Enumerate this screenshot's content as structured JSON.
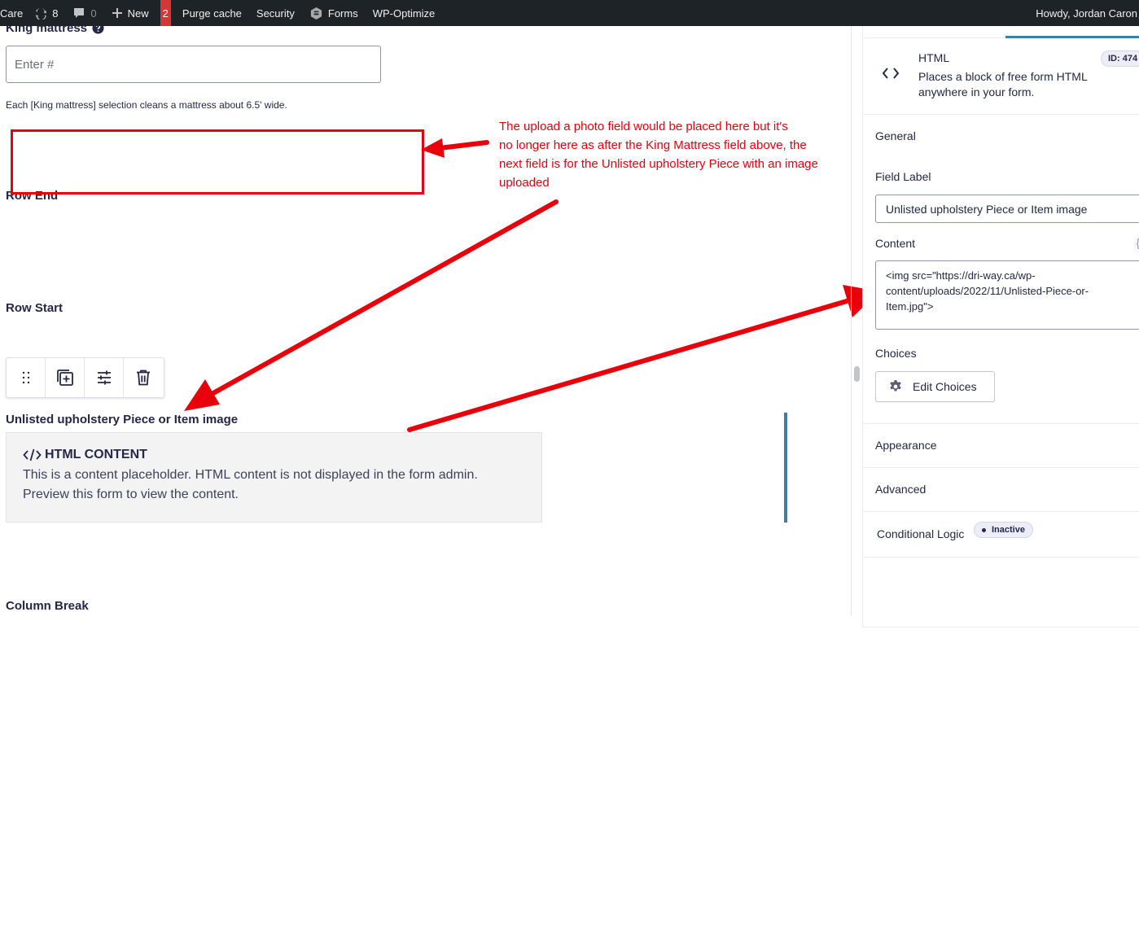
{
  "admin_bar": {
    "site": "Care",
    "updates_count": "8",
    "comments_count": "0",
    "new_label": "New",
    "badge_count": "2",
    "purge_cache": "Purge cache",
    "security": "Security",
    "forms": "Forms",
    "wp_optimize": "WP-Optimize",
    "howdy": "Howdy, Jordan Caron"
  },
  "canvas": {
    "king_label": "King mattress",
    "king_placeholder": "Enter #",
    "king_description": "Each [King mattress] selection cleans a mattress about 6.5' wide.",
    "row_end": "Row End",
    "row_start": "Row Start",
    "unlisted_label": "Unlisted upholstery Piece or Item image",
    "html_content_title": "HTML CONTENT",
    "html_content_body": "This is a content placeholder. HTML content is not displayed in the form admin. Preview this form to view the content.",
    "column_break": "Column Break"
  },
  "annotation": {
    "lines": [
      "The upload a photo field would be placed here but it's",
      "no longer here as after the King Mattress field above, the",
      "next field is for the Unlisted upholstery Piece with an image",
      "uploaded"
    ],
    "color": "#e8000b"
  },
  "panel": {
    "field_type": "HTML",
    "field_description": "Places a block of free form HTML anywhere in your form.",
    "field_id": "ID: 474",
    "general": "General",
    "field_label_label": "Field Label",
    "field_label_value": "Unlisted upholstery Piece or Item image",
    "content_label": "Content",
    "content_value": "<img src=\"https://dri-way.ca/wp-content/uploads/2022/11/Unlisted-Piece-or-Item.jpg\">",
    "choices_label": "Choices",
    "edit_choices": "Edit Choices",
    "appearance": "Appearance",
    "advanced": "Advanced",
    "conditional_logic": "Conditional Logic",
    "inactive": "Inactive",
    "accent_color": "#3e7da6"
  }
}
